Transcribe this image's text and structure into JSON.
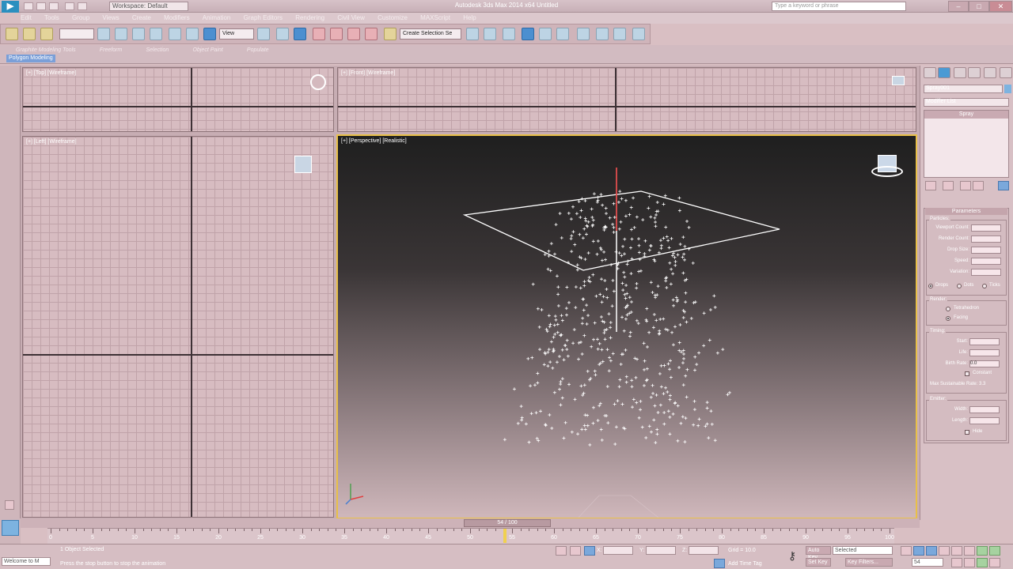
{
  "window": {
    "app_title": "Autodesk 3ds Max 2014 x64     Untitled",
    "workspace": "Workspace: Default",
    "search_placeholder": "Type a keyword or phrase",
    "min": "–",
    "max": "□",
    "close": "✕"
  },
  "menu": [
    "Edit",
    "Tools",
    "Group",
    "Views",
    "Create",
    "Modifiers",
    "Animation",
    "Graph Editors",
    "Rendering",
    "Civil View",
    "Customize",
    "MAXScript",
    "Help"
  ],
  "toolbar": {
    "undo_selector": "",
    "filter": "All",
    "view_select": "View",
    "selection_set": "Create Selection Se"
  },
  "ribbon": {
    "tabs": [
      "Graphite Modeling Tools",
      "Freeform",
      "Selection",
      "Object Paint",
      "Populate"
    ],
    "tag": "Polygon Modeling"
  },
  "viewports": {
    "top": "[+] [Top] [Wireframe]",
    "front": "[+] [Front] [Wireframe]",
    "left": "[+] [Left] [Wireframe]",
    "perspective": "[+] [Perspective] [Realistic]"
  },
  "command_panel": {
    "object_name": "Spray001",
    "modifier_list": "Modifier List",
    "stack_item": "Spray",
    "parameters_title": "Parameters",
    "particles_group": "Particles:",
    "viewport_count_label": "Viewport Count:",
    "viewport_count": "100",
    "render_count_label": "Render Count:",
    "render_count": "100",
    "drop_size_label": "Drop Size:",
    "drop_size": "2.0",
    "speed_label": "Speed:",
    "speed": "10.0",
    "variation_label": "Variation:",
    "variation": "0.0",
    "radio_drops": "Drops",
    "radio_dots": "Dots",
    "radio_ticks": "Ticks",
    "render_group": "Render:",
    "tetrahedron": "Tetrahedron",
    "facing": "Facing",
    "timing_group": "Timing:",
    "start_label": "Start:",
    "start": "0",
    "life_label": "Life:",
    "life": "30",
    "birth_rate_label": "Birth Rate:",
    "birth_rate": "0.0",
    "constant": "Constant",
    "max_sustainable": "Max Sustainable Rate: 3.3",
    "emitter_group": "Emitter:",
    "width_label": "Width:",
    "width": "50.0",
    "length_label": "Length:",
    "length": "50.0",
    "hide": "Hide"
  },
  "timeline": {
    "frame": "54 / 100",
    "ticks": [
      "0",
      "5",
      "10",
      "15",
      "20",
      "25",
      "30",
      "35",
      "40",
      "45",
      "50",
      "55",
      "60",
      "65",
      "70",
      "75",
      "80",
      "85",
      "90",
      "95",
      "100"
    ]
  },
  "status": {
    "listener": "Welcome to M",
    "selected": "1 Object Selected",
    "prompt": "Press the stop button to stop the animation",
    "x_label": "X:",
    "y_label": "Y:",
    "z_label": "Z:",
    "grid": "Grid = 10.0",
    "add_time_tag": "Add Time Tag",
    "auto_key": "Auto Key",
    "selected_dropdown": "Selected",
    "set_key": "Set Key",
    "key_filters": "Key Filters...",
    "current_frame": "54"
  }
}
